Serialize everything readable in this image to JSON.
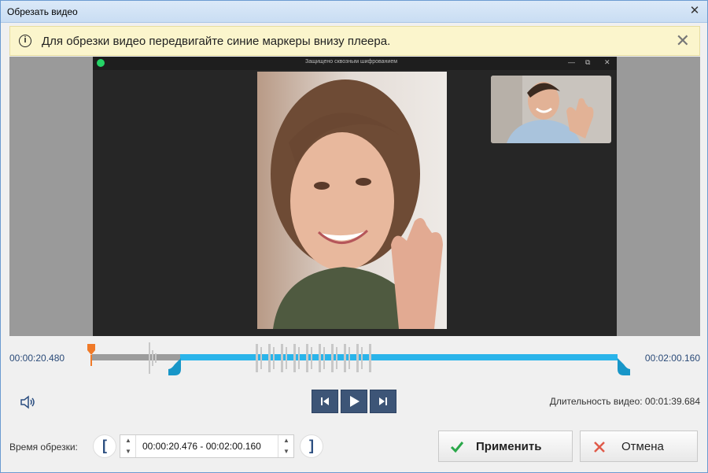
{
  "window": {
    "title": "Обрезать видео",
    "close_glyph": "✕"
  },
  "banner": {
    "text": "Для обрезки видео передвигайте синие маркеры внизу плеера.",
    "info_glyph": "i",
    "close_glyph": "✕"
  },
  "video": {
    "app_title": "Защищено сквозным шифрованием",
    "ctl_min": "—",
    "ctl_max": "⧉",
    "ctl_close": "✕"
  },
  "timeline": {
    "start_time": "00:00:20.480",
    "end_time": "00:02:00.160"
  },
  "controls": {
    "duration_label": "Длительность видео: 00:01:39.684"
  },
  "trim": {
    "label": "Время обрезки:",
    "left_bracket": "[",
    "right_bracket": "]",
    "value": "00:00:20.476 - 00:02:00.160",
    "up_glyph": "▲",
    "down_glyph": "▼"
  },
  "buttons": {
    "apply": "Применить",
    "cancel": "Отмена"
  },
  "colors": {
    "accent": "#2ab4ea",
    "playhead": "#f07a28",
    "apply_check": "#2aa84a",
    "cancel_x": "#e05a4a"
  }
}
